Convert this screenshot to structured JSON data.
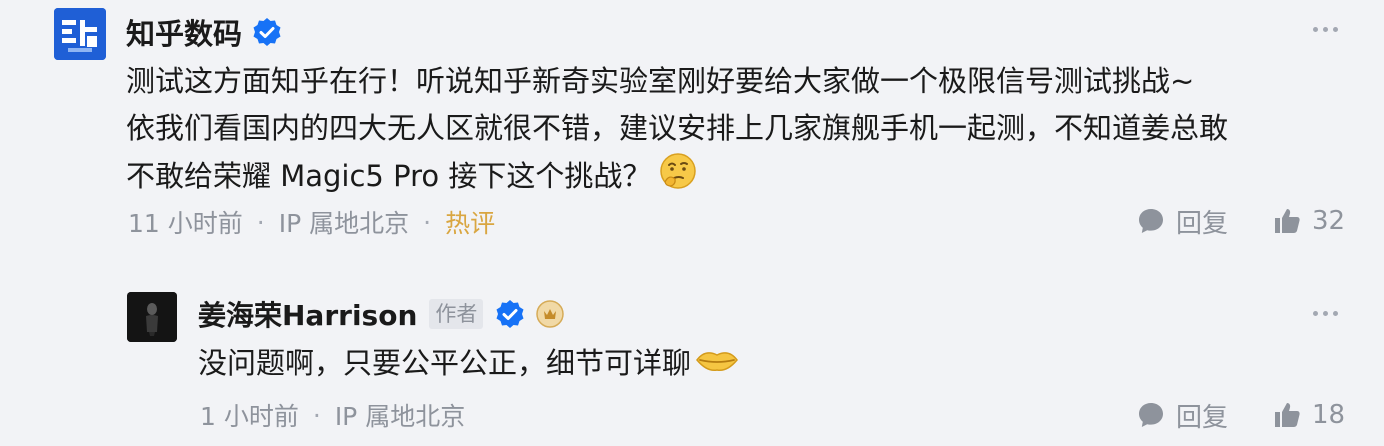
{
  "comment": {
    "author": "知乎数码",
    "body_lines": [
      "测试这方面知乎在行！听说知乎新奇实验室刚好要给大家做一个极限信号测试挑战~",
      "依我们看国内的四大无人区就很不错，建议安排上几家旗舰手机一起测，不知道姜总敢",
      "不敢给荣耀 Magic5 Pro 接下这个挑战？"
    ],
    "time": "11 小时前",
    "location": "IP 属地北京",
    "tag": "热评",
    "reply_label": "回复",
    "like_count": "32"
  },
  "reply": {
    "author": "姜海荣Harrison",
    "author_badge": "作者",
    "body": "没问题啊，只要公平公正，细节可详聊",
    "time": "1 小时前",
    "location": "IP 属地北京",
    "reply_label": "回复",
    "like_count": "18"
  },
  "separator": "·",
  "colors": {
    "background": "#f2f3f6",
    "verified_blue": "#1772f6",
    "hot_tag": "#d9a641",
    "meta_gray": "#8e939c",
    "logo_blue": "#1f5fd6"
  },
  "icons": {
    "more": "more-dots-icon",
    "verified": "verified-check-icon",
    "reply": "comment-bubble-icon",
    "like": "thumbs-up-icon",
    "emoji_comment": "thinking-face-emoji",
    "emoji_reply": "lips-emoji",
    "level_badge": "level-badge-icon"
  }
}
